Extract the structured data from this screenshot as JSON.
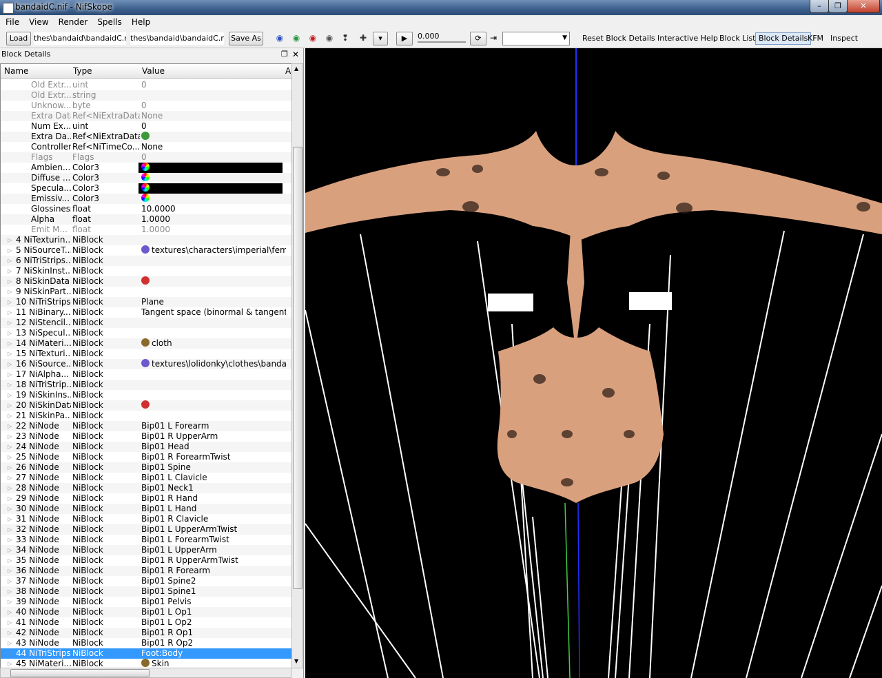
{
  "window": {
    "title": "bandaidC.nif - NifSkope",
    "minimize": "–",
    "maximize": "❐",
    "close": "✕"
  },
  "menu": [
    "File",
    "View",
    "Render",
    "Spells",
    "Help"
  ],
  "toolbar": {
    "load": "Load",
    "path1": "thes\\bandaid\\bandaidC.nif",
    "path2": "thes\\bandaid\\bandaidC.nif",
    "save_as": "Save As",
    "time_value": "0.000",
    "links": [
      "Reset Block Details",
      "Interactive Help",
      "Block List",
      "Block Details",
      "KFM",
      "Inspect"
    ]
  },
  "panel": {
    "title": "Block Details",
    "float_icon": "❐",
    "close_icon": "✕",
    "columns": [
      "Name",
      "Type",
      "Value",
      "A"
    ]
  },
  "rows": [
    {
      "name": "Old Extr...",
      "type": "uint",
      "value": "0",
      "grey": true
    },
    {
      "name": "Old Extr...",
      "type": "string",
      "value": "",
      "grey": true
    },
    {
      "name": "Unknow...",
      "type": "byte",
      "value": "0",
      "grey": true
    },
    {
      "name": "Extra Data",
      "type": "Ref<NiExtraData>",
      "value": "None",
      "grey": true
    },
    {
      "name": "Num Ex...",
      "type": "uint",
      "value": "0"
    },
    {
      "name": "Extra Da...",
      "type": "Ref<NiExtraData>",
      "value": "",
      "icon": "leaf-icon"
    },
    {
      "name": "Controller",
      "type": "Ref<NiTimeCo...",
      "value": "None"
    },
    {
      "name": "Flags",
      "type": "Flags",
      "value": "0",
      "grey": true
    },
    {
      "name": "Ambien...",
      "type": "Color3",
      "value": "",
      "icon": "color-wheel-icon"
    },
    {
      "name": "Diffuse ...",
      "type": "Color3",
      "value": "",
      "icon": "color-wheel-icon"
    },
    {
      "name": "Specula...",
      "type": "Color3",
      "value": "",
      "icon": "color-wheel-icon"
    },
    {
      "name": "Emissiv...",
      "type": "Color3",
      "value": "",
      "icon": "color-wheel-icon"
    },
    {
      "name": "Glossiness",
      "type": "float",
      "value": "10.0000"
    },
    {
      "name": "Alpha",
      "type": "float",
      "value": "1.0000"
    },
    {
      "name": "Emit M...",
      "type": "float",
      "value": "1.0000",
      "grey": true
    },
    {
      "name": "4 NiTexturin...",
      "type": "NiBlock",
      "value": "",
      "block": true
    },
    {
      "name": "5 NiSourceT...",
      "type": "NiBlock",
      "value": "textures\\characters\\imperial\\fem...",
      "block": true,
      "icon": "texture-icon"
    },
    {
      "name": "6 NiTriStrips...",
      "type": "NiBlock",
      "value": "",
      "block": true
    },
    {
      "name": "7 NiSkinInst...",
      "type": "NiBlock",
      "value": "",
      "block": true
    },
    {
      "name": "8 NiSkinData",
      "type": "NiBlock",
      "value": "",
      "block": true,
      "icon": "skin-icon"
    },
    {
      "name": "9 NiSkinPart...",
      "type": "NiBlock",
      "value": "",
      "block": true
    },
    {
      "name": "10 NiTriStrips",
      "type": "NiBlock",
      "value": "Plane",
      "block": true
    },
    {
      "name": "11 NiBinary...",
      "type": "NiBlock",
      "value": "Tangent space (binormal & tangent ...",
      "block": true
    },
    {
      "name": "12 NiStencil...",
      "type": "NiBlock",
      "value": "",
      "block": true
    },
    {
      "name": "13 NiSpecul...",
      "type": "NiBlock",
      "value": "",
      "block": true
    },
    {
      "name": "14 NiMateri...",
      "type": "NiBlock",
      "value": "cloth",
      "block": true,
      "icon": "palette-icon"
    },
    {
      "name": "15 NiTexturi...",
      "type": "NiBlock",
      "value": "",
      "block": true
    },
    {
      "name": "16 NiSource...",
      "type": "NiBlock",
      "value": "textures\\lolidonky\\clothes\\banda...",
      "block": true,
      "icon": "texture-icon"
    },
    {
      "name": "17 NiAlpha...",
      "type": "NiBlock",
      "value": "",
      "block": true
    },
    {
      "name": "18 NiTriStrip...",
      "type": "NiBlock",
      "value": "",
      "block": true
    },
    {
      "name": "19 NiSkinIns...",
      "type": "NiBlock",
      "value": "",
      "block": true
    },
    {
      "name": "20 NiSkinData",
      "type": "NiBlock",
      "value": "",
      "block": true,
      "icon": "skin-icon"
    },
    {
      "name": "21 NiSkinPa...",
      "type": "NiBlock",
      "value": "",
      "block": true
    },
    {
      "name": "22 NiNode",
      "type": "NiBlock",
      "value": "Bip01 L Forearm",
      "block": true
    },
    {
      "name": "23 NiNode",
      "type": "NiBlock",
      "value": "Bip01 R UpperArm",
      "block": true
    },
    {
      "name": "24 NiNode",
      "type": "NiBlock",
      "value": "Bip01 Head",
      "block": true
    },
    {
      "name": "25 NiNode",
      "type": "NiBlock",
      "value": "Bip01 R ForearmTwist",
      "block": true
    },
    {
      "name": "26 NiNode",
      "type": "NiBlock",
      "value": "Bip01 Spine",
      "block": true
    },
    {
      "name": "27 NiNode",
      "type": "NiBlock",
      "value": "Bip01 L Clavicle",
      "block": true
    },
    {
      "name": "28 NiNode",
      "type": "NiBlock",
      "value": "Bip01 Neck1",
      "block": true
    },
    {
      "name": "29 NiNode",
      "type": "NiBlock",
      "value": "Bip01 R Hand",
      "block": true
    },
    {
      "name": "30 NiNode",
      "type": "NiBlock",
      "value": "Bip01 L Hand",
      "block": true
    },
    {
      "name": "31 NiNode",
      "type": "NiBlock",
      "value": "Bip01 R Clavicle",
      "block": true
    },
    {
      "name": "32 NiNode",
      "type": "NiBlock",
      "value": "Bip01 L UpperArmTwist",
      "block": true
    },
    {
      "name": "33 NiNode",
      "type": "NiBlock",
      "value": "Bip01 L ForearmTwist",
      "block": true
    },
    {
      "name": "34 NiNode",
      "type": "NiBlock",
      "value": "Bip01 L UpperArm",
      "block": true
    },
    {
      "name": "35 NiNode",
      "type": "NiBlock",
      "value": "Bip01 R UpperArmTwist",
      "block": true
    },
    {
      "name": "36 NiNode",
      "type": "NiBlock",
      "value": "Bip01 R Forearm",
      "block": true
    },
    {
      "name": "37 NiNode",
      "type": "NiBlock",
      "value": "Bip01 Spine2",
      "block": true
    },
    {
      "name": "38 NiNode",
      "type": "NiBlock",
      "value": "Bip01 Spine1",
      "block": true
    },
    {
      "name": "39 NiNode",
      "type": "NiBlock",
      "value": "Bip01 Pelvis",
      "block": true
    },
    {
      "name": "40 NiNode",
      "type": "NiBlock",
      "value": "Bip01 L Op1",
      "block": true
    },
    {
      "name": "41 NiNode",
      "type": "NiBlock",
      "value": "Bip01 L Op2",
      "block": true
    },
    {
      "name": "42 NiNode",
      "type": "NiBlock",
      "value": "Bip01 R Op1",
      "block": true
    },
    {
      "name": "43 NiNode",
      "type": "NiBlock",
      "value": "Bip01 R Op2",
      "block": true
    },
    {
      "name": "44 NiTriStrips",
      "type": "NiBlock",
      "value": "Foot:Body",
      "block": true,
      "selected": true
    },
    {
      "name": "45 NiMateri...",
      "type": "NiBlock",
      "value": "Skin",
      "block": true,
      "icon": "palette-icon"
    }
  ],
  "colors": {
    "selection": "#3399ff",
    "skin": "#d9a07e",
    "viewport_bg": "#000000",
    "axis_blue": "#2030ff",
    "bone_white": "#ffffff"
  }
}
